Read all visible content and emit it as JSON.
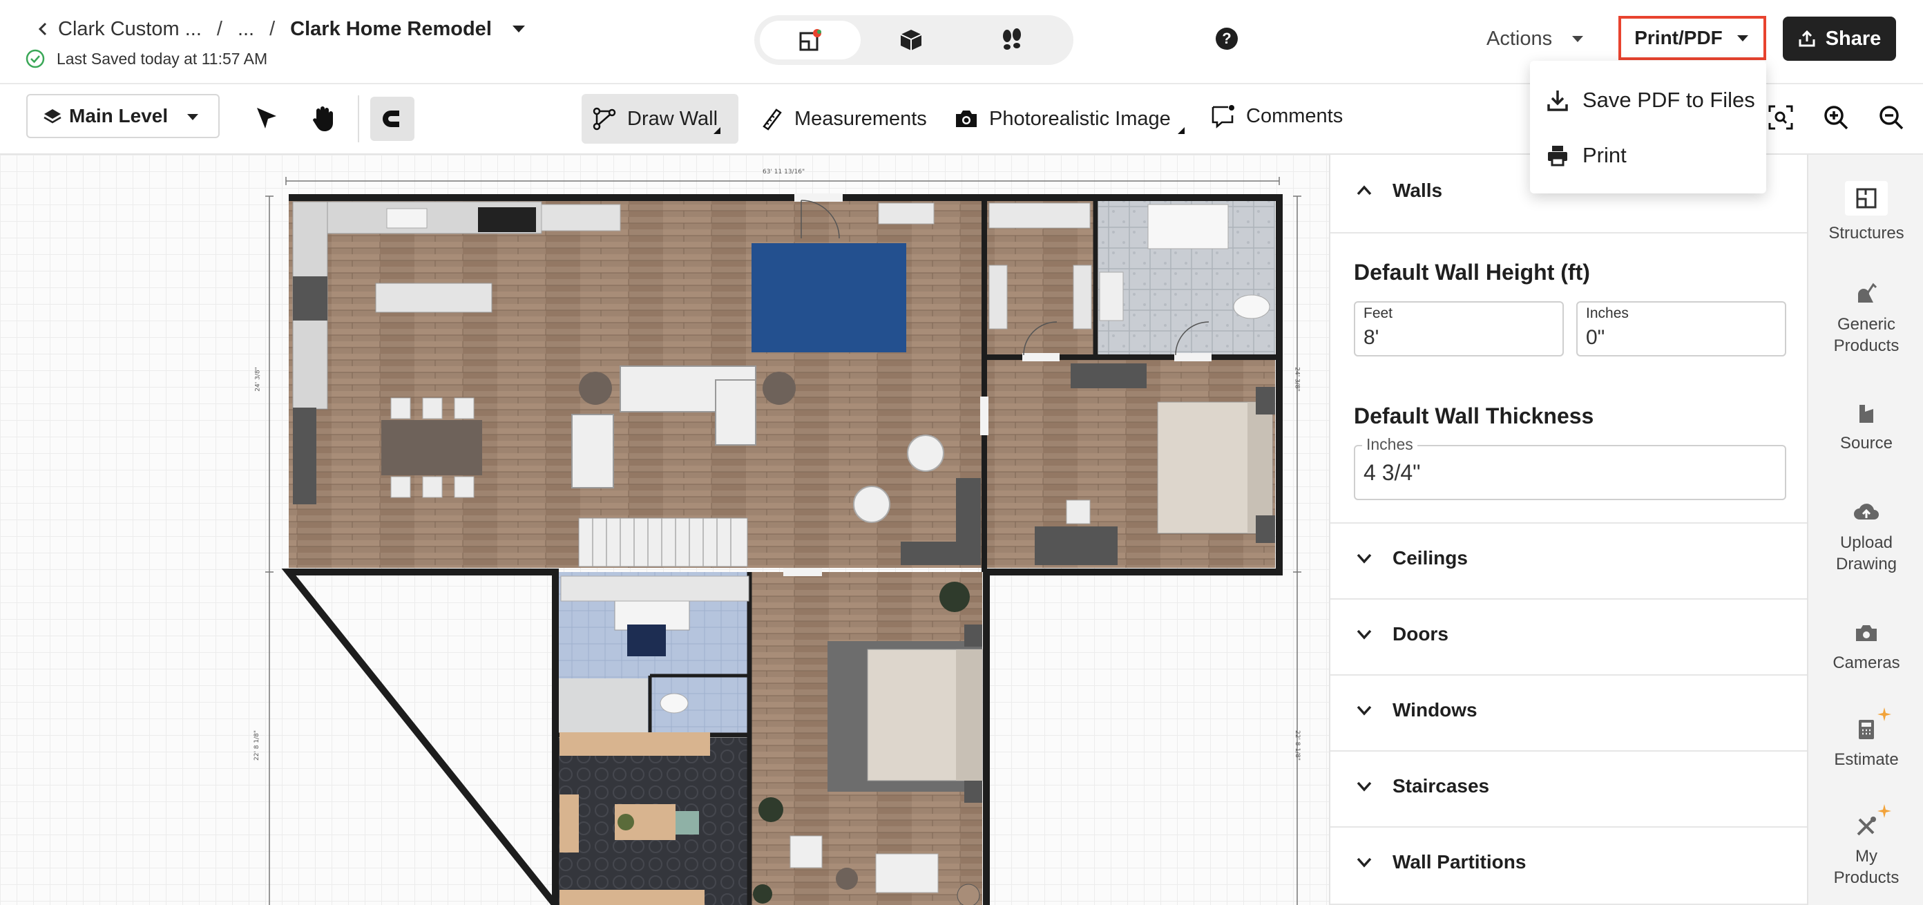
{
  "header": {
    "breadcrumb": {
      "root": "Clark Custom ...",
      "ellipsis": "...",
      "separator": "/",
      "project": "Clark Home Remodel"
    },
    "saved_status": "Last Saved today at 11:57 AM",
    "help_label": "?",
    "actions_label": "Actions",
    "print_label": "Print/PDF",
    "share_label": "Share",
    "view_modes": [
      "2d-floorplan-icon",
      "3d-box-icon",
      "walkthrough-footsteps-icon"
    ]
  },
  "print_menu": {
    "items": [
      {
        "label": "Save PDF to Files",
        "icon": "download-icon"
      },
      {
        "label": "Print",
        "icon": "printer-icon"
      }
    ]
  },
  "toolbar": {
    "level": "Main Level",
    "tools": [
      {
        "label": "Draw Wall",
        "active": true
      },
      {
        "label": "Measurements",
        "active": false
      },
      {
        "label": "Photorealistic Image",
        "active": false
      },
      {
        "label": "Comments",
        "active": false
      }
    ]
  },
  "canvas": {
    "dim_top": "63' 11 13/16\"",
    "dim_left_upper": "24' 3/8\"",
    "dim_right_upper": "24' 3/8\"",
    "dim_left_lower": "22' 8 1/8\"",
    "dim_right_lower": "22' 8 1/8\""
  },
  "panel": {
    "walls": {
      "title": "Walls",
      "height_title": "Default Wall Height (ft)",
      "feet_label": "Feet",
      "feet_value": "8'",
      "inches_label": "Inches",
      "inches_value": "0\"",
      "thickness_title": "Default Wall Thickness",
      "thickness_label": "Inches",
      "thickness_value": "4 3/4\""
    },
    "sections": [
      "Ceilings",
      "Doors",
      "Windows",
      "Staircases",
      "Wall Partitions"
    ]
  },
  "rail": {
    "items": [
      "Structures",
      "Generic Products",
      "Source",
      "Upload Drawing",
      "Cameras",
      "Estimate",
      "My Products"
    ]
  },
  "colors": {
    "accent_red": "#e8432f",
    "share_bg": "#222222",
    "rug_blue": "#23508f"
  }
}
